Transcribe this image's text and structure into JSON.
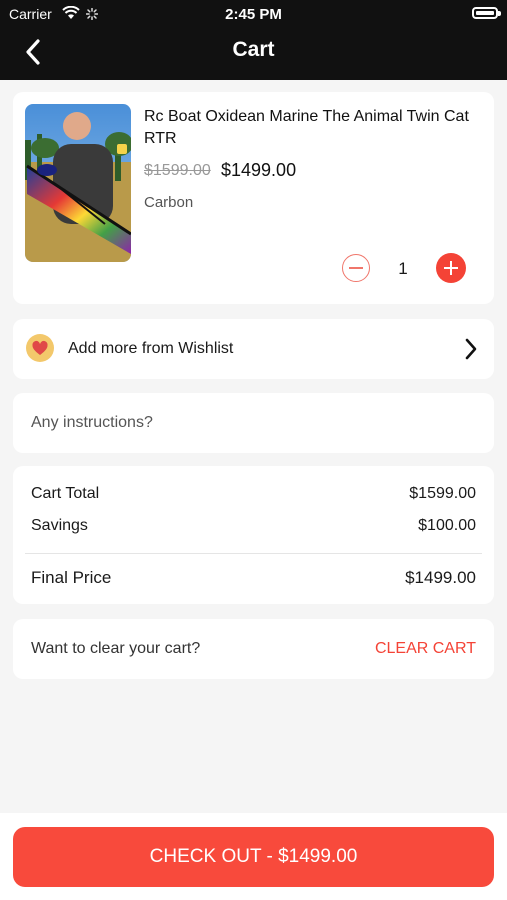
{
  "status_bar": {
    "carrier": "Carrier",
    "time": "2:45 PM"
  },
  "header": {
    "title": "Cart",
    "back_icon": "chevron-left-icon"
  },
  "product": {
    "name": "Rc Boat Oxidean Marine The Animal Twin Cat RTR",
    "old_price": "$1599.00",
    "price": "$1499.00",
    "variant": "Carbon",
    "quantity": "1"
  },
  "wishlist": {
    "label": "Add more from Wishlist",
    "icon": "heart-icon"
  },
  "instructions": {
    "placeholder": "Any instructions?"
  },
  "totals": {
    "cart_total_label": "Cart Total",
    "cart_total_value": "$1599.00",
    "savings_label": "Savings",
    "savings_value": "$100.00",
    "final_label": "Final Price",
    "final_value": "$1499.00"
  },
  "clear_cart": {
    "question": "Want to clear your cart?",
    "button": "CLEAR CART"
  },
  "checkout": {
    "label": "CHECK OUT - $1499.00"
  },
  "colors": {
    "accent": "#f44336",
    "header_bg": "#111111"
  }
}
